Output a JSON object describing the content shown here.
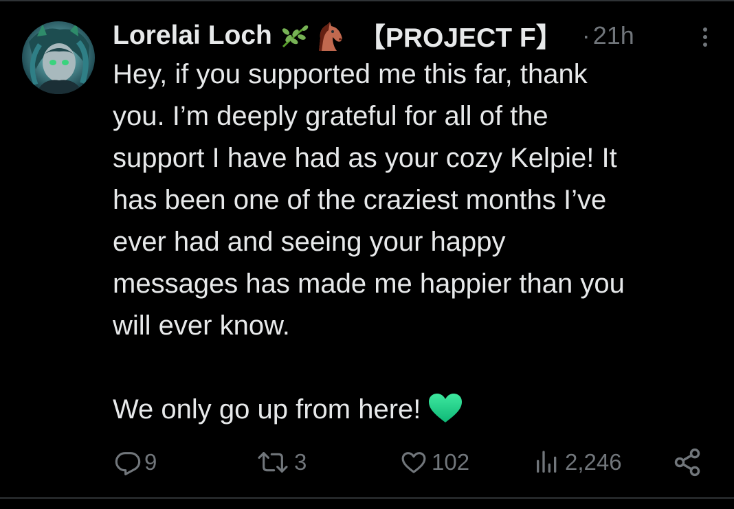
{
  "tweet": {
    "author": {
      "display_name": "Lorelai Loch",
      "name_emojis": [
        "herb-emoji",
        "horse-emoji"
      ],
      "tag": "【PROJECT F】"
    },
    "separator": "·",
    "timestamp": "21h",
    "text_lines": [
      "Hey, if you supported me this far, thank",
      "you. I’m deeply grateful for all of the",
      "support I have had as your cozy Kelpie! It",
      "has been one of the craziest months I’ve",
      "ever had and seeing your happy",
      "messages has made me happier than you",
      "will ever know."
    ],
    "closing_line": "We only go up from here!",
    "closing_emoji": "green-heart-emoji"
  },
  "actions": {
    "replies": "9",
    "reposts": "3",
    "likes": "102",
    "views": "2,246"
  },
  "icons": {
    "reply": "reply-icon",
    "repost": "repost-icon",
    "like": "like-icon",
    "views": "views-icon",
    "share": "share-icon",
    "more": "more-icon"
  },
  "colors": {
    "background": "#000000",
    "text": "#e7e9ea",
    "muted": "#71767b",
    "heart": "#1fd19a"
  }
}
